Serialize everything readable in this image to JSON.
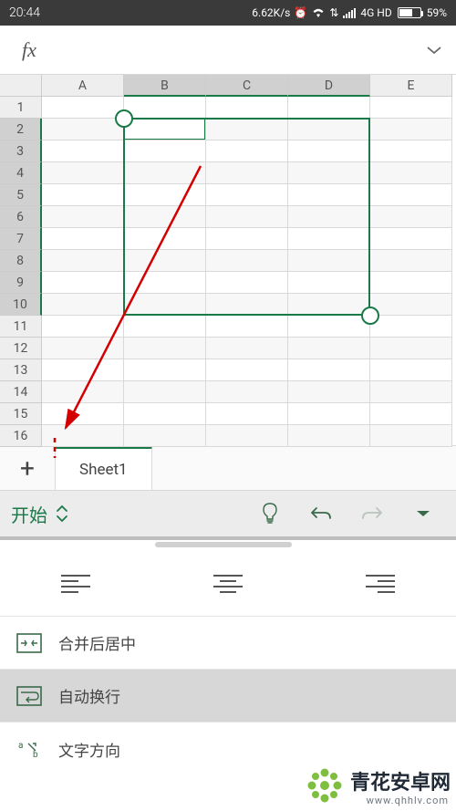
{
  "status": {
    "time": "20:44",
    "speed": "6.62K/s",
    "net": "4G HD",
    "battery": "59%"
  },
  "formula": {
    "fx": "fx"
  },
  "cols": [
    "A",
    "B",
    "C",
    "D",
    "E"
  ],
  "rows": [
    "1",
    "2",
    "3",
    "4",
    "5",
    "6",
    "7",
    "8",
    "9",
    "10",
    "11",
    "12",
    "13",
    "14",
    "15",
    "16"
  ],
  "selection": {
    "startCol": 2,
    "endCol": 4,
    "startRow": 2,
    "endRow": 10
  },
  "tabs": {
    "sheet": "Sheet1",
    "add": "+"
  },
  "ribbon": {
    "start": "开始"
  },
  "options": {
    "merge": "合并后居中",
    "wrap": "自动换行",
    "direction": "文字方向"
  },
  "watermark": {
    "text": "青花安卓网",
    "url": "www.qhhlv.com"
  },
  "colors": {
    "accent": "#1a7a47",
    "watermark": "#7fbf3f"
  }
}
